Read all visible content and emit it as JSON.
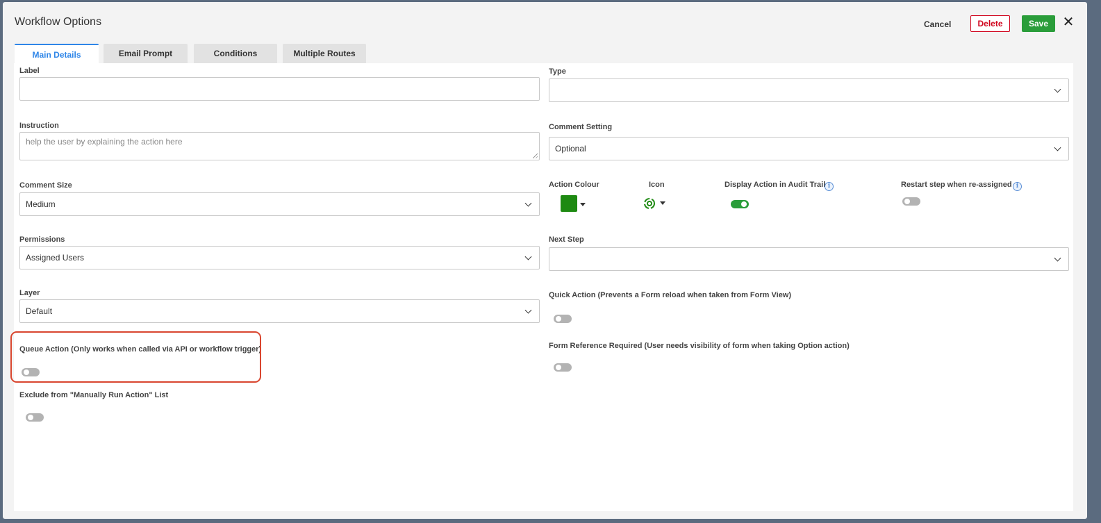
{
  "dialog": {
    "title": "Workflow Options",
    "cancel_label": "Cancel",
    "delete_label": "Delete",
    "save_label": "Save",
    "close_glyph": "✕"
  },
  "tabs": [
    {
      "label": "Main Details",
      "active": true
    },
    {
      "label": "Email Prompt",
      "active": false
    },
    {
      "label": "Conditions",
      "active": false
    },
    {
      "label": "Multiple Routes",
      "active": false
    }
  ],
  "form": {
    "label": {
      "label": "Label",
      "value": ""
    },
    "type": {
      "label": "Type",
      "value": ""
    },
    "instruction": {
      "label": "Instruction",
      "placeholder": "help the user by explaining the action here"
    },
    "comment_setting": {
      "label": "Comment Setting",
      "value": "Optional"
    },
    "comment_size": {
      "label": "Comment Size",
      "value": "Medium"
    },
    "action_colour": {
      "label": "Action Colour",
      "color": "#1e8a12"
    },
    "icon": {
      "label": "Icon",
      "icon_name": "refresh-gear-icon"
    },
    "display_in_audit": {
      "label": "Display Action in Audit Trail",
      "on": true
    },
    "restart_step": {
      "label": "Restart step when re-assigned",
      "on": false
    },
    "permissions": {
      "label": "Permissions",
      "value": "Assigned Users"
    },
    "next_step": {
      "label": "Next Step",
      "value": ""
    },
    "layer": {
      "label": "Layer",
      "value": "Default"
    },
    "quick_action": {
      "label": "Quick Action (Prevents a Form reload when taken from Form View)",
      "on": false
    },
    "queue_action": {
      "label": "Queue Action (Only works when called via API or workflow trigger)",
      "on": false
    },
    "form_reference": {
      "label": "Form Reference Required (User needs visibility of form when taking Option action)",
      "on": false
    },
    "exclude_manual": {
      "label": "Exclude from \"Manually Run Action\" List",
      "on": false
    }
  },
  "colors": {
    "accent_blue": "#2f86e8",
    "save_green": "#2a9d3a",
    "delete_red": "#d0021b",
    "highlight_red": "#d9462f"
  }
}
